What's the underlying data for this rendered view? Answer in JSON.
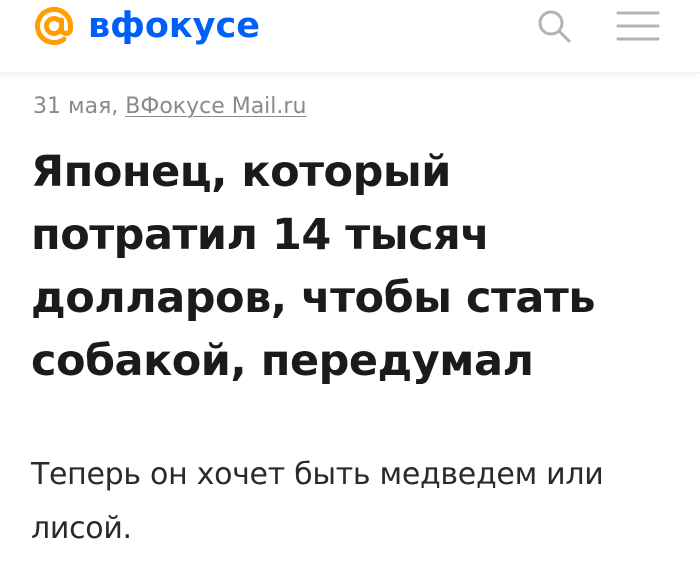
{
  "header": {
    "logo_text": "вфокусе",
    "brand_color": "#005ff9",
    "logo_accent_color": "#ff9e00",
    "icons": [
      "at-sign-logo-icon",
      "search-icon",
      "hamburger-menu-icon"
    ]
  },
  "article": {
    "date": "31 мая,",
    "source": "ВФокусе Mail.ru",
    "title_lines": [
      "Японец, который",
      "потратил 14 тысяч",
      "долларов, чтобы стать",
      "собакой, передумал"
    ],
    "lead_lines": [
      "Теперь он хочет быть медведем или",
      "лисой."
    ]
  }
}
